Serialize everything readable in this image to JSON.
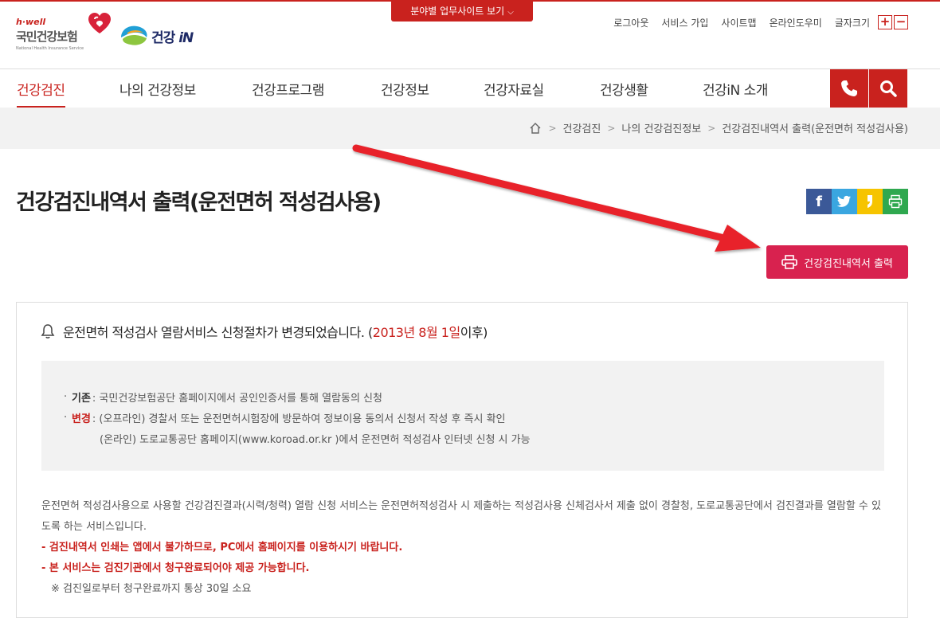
{
  "header": {
    "site_button": "분야별 업무사이트 보기",
    "logo_nhis": {
      "tagline": "h·well",
      "name": "국민건강보험",
      "eng": "National Health Insurance Service"
    },
    "logo_in": {
      "text_kr": "건강",
      "text_in": "iN"
    },
    "util_links": [
      "로그아웃",
      "서비스 가입",
      "사이트맵",
      "온라인도우미",
      "글자크기"
    ],
    "font_plus": "+",
    "font_minus": "−"
  },
  "nav": {
    "items": [
      "건강검진",
      "나의 건강정보",
      "건강프로그램",
      "건강정보",
      "건강자료실",
      "건강생활",
      "건강iN 소개"
    ],
    "active": "건강검진"
  },
  "breadcrumb": {
    "items": [
      "건강검진",
      "나의 건강검진정보",
      "건강검진내역서 출력(운전면허 적성검사용)"
    ]
  },
  "page": {
    "title": "건강검진내역서 출력(운전면허 적성검사용)",
    "print_button": "건강검진내역서 출력"
  },
  "share": {
    "facebook": "f",
    "twitter_color": "#3aa6e0",
    "kakaostory_color": "#f6c400",
    "print_color": "#2fa84f",
    "facebook_color": "#3b5998"
  },
  "notice": {
    "head_prefix": "운전면허 적성검사 열람서비스 신청절차가 변경되었습니다. (",
    "head_date": "2013년 8월 1일",
    "head_suffix": " 이후)",
    "standard_label": "기존",
    "standard_text": ": 국민건강보험공단 홈페이지에서 공인인증서를 통해 열람동의 신청",
    "change_label": "변경",
    "change_text1": ": (오프라인) 경찰서 또는 운전면허시험장에 방문하여 정보이용 동의서 신청서 작성 후 즉시 확인",
    "change_text2": "(온라인) 도로교통공단 홈페이지(www.koroad.or.kr )에서 운전면허 적성검사 인터넷 신청 시 가능",
    "desc": "운전면허 적성검사용으로 사용할 건강검진결과(시력/청력) 열람 신청 서비스는 운전면허적성검사 시 제출하는 적성검사용 신체검사서 제출 없이 경찰청, 도로교통공단에서 검진결과를 열람할 수 있도록 하는 서비스입니다.",
    "warn1": "- 검진내역서 인쇄는 앱에서 불가하므로, PC에서 홈페이지를 이용하시기 바랍니다.",
    "warn2": "- 본 서비스는 검진기관에서 청구완료되어야 제공 가능합니다.",
    "note": "※ 검진일로부터 청구완료까지 통상 30일 소요"
  },
  "colors": {
    "brand_red": "#c9221e",
    "print_button": "#d8224f"
  }
}
